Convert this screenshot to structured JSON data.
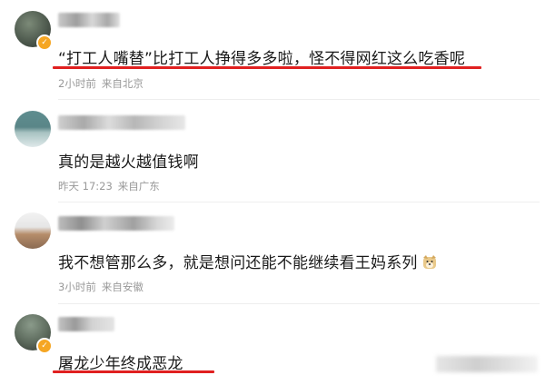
{
  "accent_color": "#e02020",
  "comments": [
    {
      "text": "“打工人嘴替”比打工人挣得多多啦，怪不得网红这么吃香呢",
      "time": "2小时前",
      "location": "来自北京",
      "verified": true,
      "underlined": true
    },
    {
      "text": "真的是越火越值钱啊",
      "time": "昨天 17:23",
      "location": "来自广东",
      "verified": false,
      "underlined": false
    },
    {
      "text": "我不想管那么多，就是想问还能不能继续看王妈系列",
      "time": "3小时前",
      "location": "来自安徽",
      "verified": false,
      "underlined": false,
      "emoji": "dog-face-emoji"
    },
    {
      "text": "屠龙少年终成恶龙",
      "verified": true,
      "underlined": true
    }
  ]
}
